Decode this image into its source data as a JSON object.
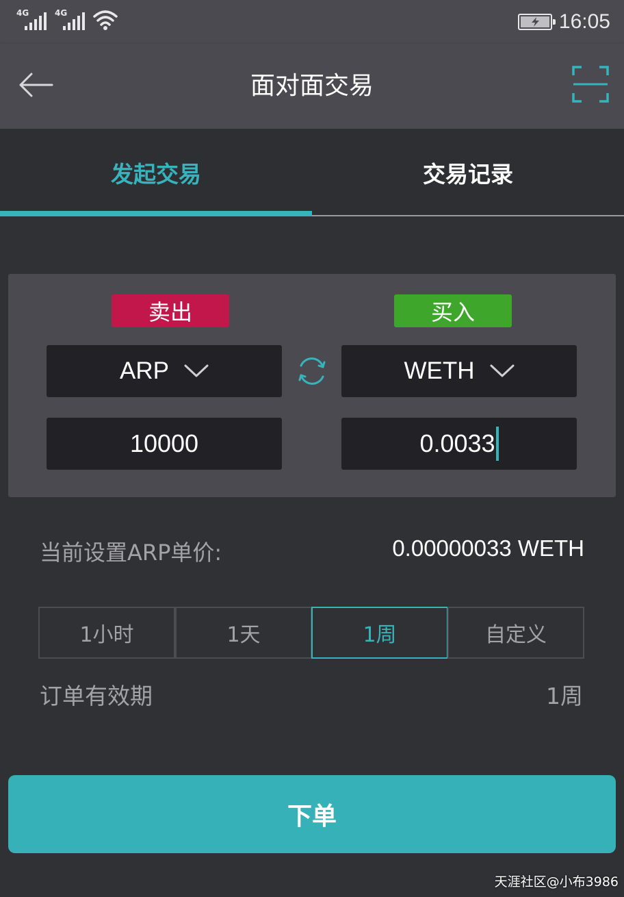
{
  "status_bar": {
    "network_1": "4G",
    "network_2": "4G",
    "time": "16:05"
  },
  "header": {
    "title": "面对面交易",
    "back_icon": "arrow-left-icon",
    "scan_icon": "scan-icon"
  },
  "tabs": [
    {
      "label": "发起交易",
      "active": true
    },
    {
      "label": "交易记录",
      "active": false
    }
  ],
  "trade": {
    "sell_label": "卖出",
    "buy_label": "买入",
    "sell_token": "ARP",
    "buy_token": "WETH",
    "sell_amount": "10000",
    "buy_amount": "0.0033"
  },
  "price": {
    "label": "当前设置ARP单价:",
    "value": "0.00000033 WETH"
  },
  "durations": [
    {
      "label": "1小时",
      "selected": false
    },
    {
      "label": "1天",
      "selected": false
    },
    {
      "label": "1周",
      "selected": true
    },
    {
      "label": "自定义",
      "selected": false
    }
  ],
  "validity": {
    "label": "订单有效期",
    "value": "1周"
  },
  "submit_label": "下单",
  "watermark": "天涯社区@小布3986",
  "colors": {
    "accent": "#37b4bb",
    "sell": "#c2174a",
    "buy": "#3ea72b",
    "background": "#303135",
    "panel": "#4a4a50"
  }
}
